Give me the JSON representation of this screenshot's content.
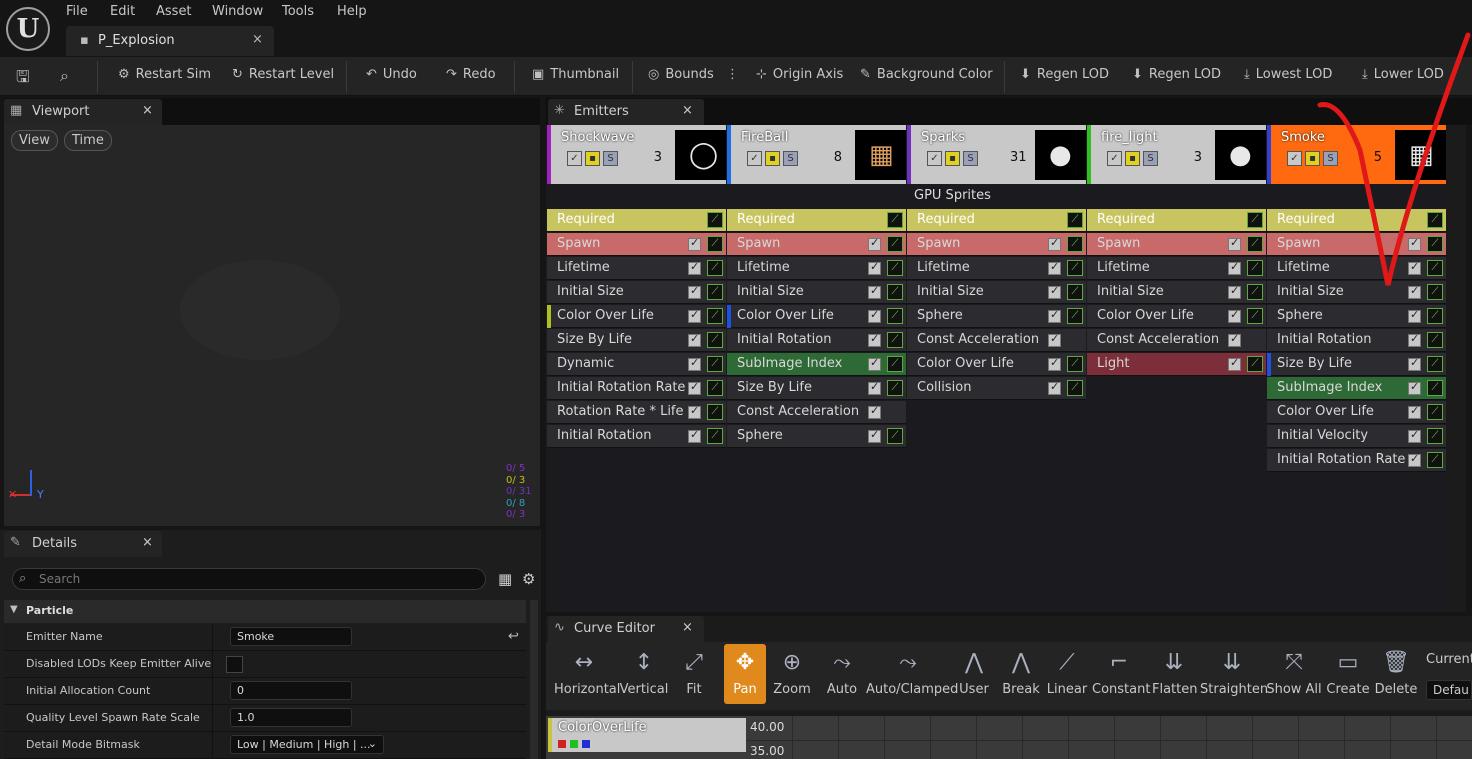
{
  "menu": [
    "File",
    "Edit",
    "Asset",
    "Window",
    "Tools",
    "Help"
  ],
  "doc_tab": "P_Explosion",
  "toolbar": [
    "Restart Sim",
    "Restart Level",
    "Undo",
    "Redo",
    "Thumbnail",
    "Bounds",
    "Origin Axis",
    "Background Color",
    "Regen LOD",
    "Regen LOD",
    "Lowest LOD",
    "Lower LOD"
  ],
  "viewport": {
    "tab": "Viewport",
    "view": "View",
    "time": "Time",
    "stats": [
      "0/ 5",
      "0/ 3",
      "0/ 31",
      "0/ 8",
      "0/ 3"
    ]
  },
  "details": {
    "tab": "Details",
    "search_placeholder": "Search",
    "section": "Particle",
    "rows": [
      {
        "label": "Emitter Name",
        "value": "Smoke"
      },
      {
        "label": "Disabled LODs Keep Emitter Alive",
        "value": ""
      },
      {
        "label": "Initial Allocation Count",
        "value": "0"
      },
      {
        "label": "Quality Level Spawn Rate Scale",
        "value": "1.0"
      },
      {
        "label": "Detail Mode Bitmask",
        "value": "Low | Medium | High | ..."
      }
    ]
  },
  "emitters_tab": "Emitters",
  "emitters": [
    {
      "name": "Shockwave",
      "count": "3",
      "color": "#a020c0",
      "gpu": "",
      "modules": [
        [
          "Required",
          "req"
        ],
        [
          "Spawn",
          "spawn"
        ],
        [
          "Lifetime",
          ""
        ],
        [
          "Initial Size",
          ""
        ],
        [
          "Color Over Life",
          "",
          ""
        ],
        [
          "Size By Life",
          ""
        ],
        [
          "Dynamic",
          ""
        ],
        [
          "Initial Rotation Rate",
          ""
        ],
        [
          "Rotation Rate * Life",
          ""
        ],
        [
          "Initial Rotation",
          ""
        ]
      ]
    },
    {
      "name": "FireBall",
      "count": "8",
      "color": "#1e6ee8",
      "gpu": "",
      "modules": [
        [
          "Required",
          "req"
        ],
        [
          "Spawn",
          "spawn"
        ],
        [
          "Lifetime",
          ""
        ],
        [
          "Initial Size",
          ""
        ],
        [
          "Color Over Life",
          ""
        ],
        [
          "Initial Rotation",
          ""
        ],
        [
          "SubImage Index",
          "green"
        ],
        [
          "Size By Life",
          ""
        ],
        [
          "Const Acceleration",
          "",
          ""
        ],
        [
          "Sphere",
          ""
        ]
      ]
    },
    {
      "name": "Sparks",
      "count": "31",
      "color": "#7030c0",
      "gpu": "GPU Sprites",
      "modules": [
        [
          "Required",
          "req"
        ],
        [
          "Spawn",
          "spawn"
        ],
        [
          "Lifetime",
          ""
        ],
        [
          "Initial Size",
          ""
        ],
        [
          "Sphere",
          ""
        ],
        [
          "Const Acceleration",
          ""
        ],
        [
          "Color Over Life",
          ""
        ],
        [
          "Collision",
          ""
        ]
      ]
    },
    {
      "name": "fire_light",
      "count": "3",
      "color": "#30c020",
      "gpu": "",
      "modules": [
        [
          "Required",
          "req"
        ],
        [
          "Spawn",
          "spawn"
        ],
        [
          "Lifetime",
          ""
        ],
        [
          "Initial Size",
          ""
        ],
        [
          "Color Over Life",
          ""
        ],
        [
          "Const Acceleration",
          ""
        ],
        [
          "Light",
          "light"
        ]
      ]
    },
    {
      "name": "Smoke",
      "count": "5",
      "color": "#3040d0",
      "gpu": "",
      "modules": [
        [
          "Required",
          "req"
        ],
        [
          "Spawn",
          "spawn"
        ],
        [
          "Lifetime",
          ""
        ],
        [
          "Initial Size",
          ""
        ],
        [
          "Sphere",
          ""
        ],
        [
          "Initial Rotation",
          ""
        ],
        [
          "Size By Life",
          ""
        ],
        [
          "SubImage Index",
          "green"
        ],
        [
          "Color Over Life",
          ""
        ],
        [
          "Initial Velocity",
          ""
        ],
        [
          "Initial Rotation Rate",
          ""
        ]
      ]
    }
  ],
  "curve": {
    "tab": "Curve Editor",
    "buttons": [
      "Horizontal",
      "Vertical",
      "Fit",
      "Pan",
      "Zoom",
      "Auto",
      "Auto/Clamped",
      "User",
      "Break",
      "Linear",
      "Constant",
      "Flatten",
      "Straighten",
      "Show All",
      "Create",
      "Delete"
    ],
    "current": "Current",
    "default": "Defau",
    "track": "ColorOverLife",
    "ticks": [
      "40.00",
      "35.00"
    ]
  }
}
